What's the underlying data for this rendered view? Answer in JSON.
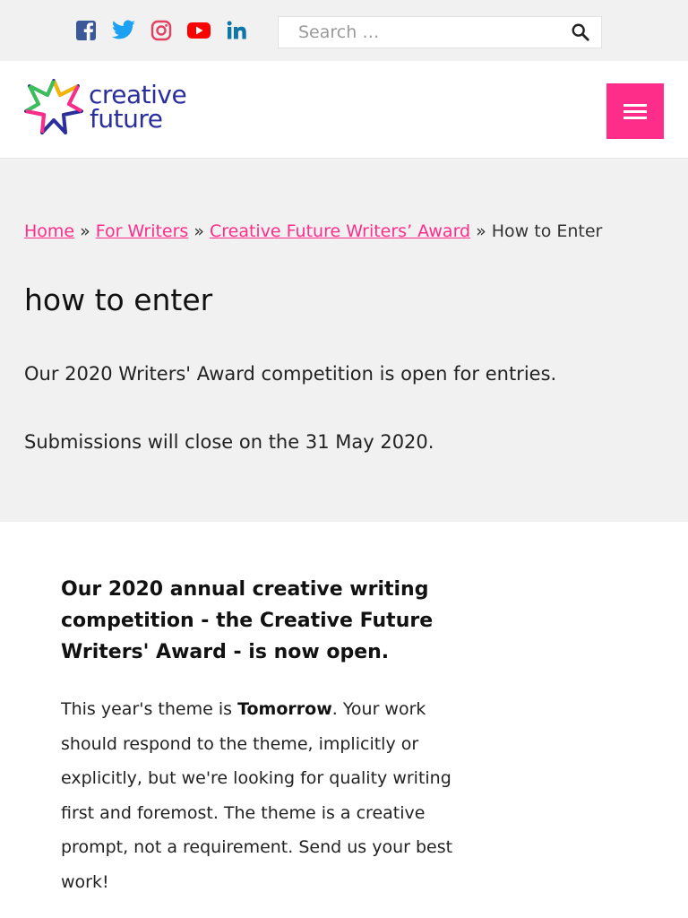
{
  "topbar": {
    "social": [
      {
        "name": "facebook-icon",
        "color": "#3b5998"
      },
      {
        "name": "twitter-icon",
        "color": "#1da1f2"
      },
      {
        "name": "instagram-icon",
        "color": "#e4405f"
      },
      {
        "name": "youtube-icon",
        "color": "#ff0000"
      },
      {
        "name": "linkedin-icon",
        "color": "#0e76a8"
      }
    ],
    "search": {
      "placeholder": "Search …",
      "icon": "search-icon"
    }
  },
  "header": {
    "logo": {
      "line1": "creative",
      "line2": "future",
      "color": "#2a2f9c"
    },
    "menu_icon": "hamburger-menu-icon",
    "menu_color": "#ff2d8a"
  },
  "breadcrumb": {
    "home": "Home",
    "for_writers": "For Writers",
    "award": "Creative Future Writers’ Award",
    "current": "How to Enter",
    "separator": "»"
  },
  "hero": {
    "title": "how to enter",
    "p1": "Our 2020 Writers' Award competition is open for entries.",
    "p2": "Submissions will close on the 31 May 2020."
  },
  "content": {
    "heading": "Our 2020 annual creative writing competition - the Creative Future Writers' Award - is now open.",
    "body_pre": "This year's theme is ",
    "body_bold": "Tomorrow",
    "body_post": ". Your work should respond to the theme, implicitly or explicitly, but we're looking for quality writing first and foremost. The theme is a creative prompt, not a requirement. Send us your best work!"
  },
  "colors": {
    "accent": "#ff2d8a",
    "bg_grey": "#f1f1f1",
    "brand_blue": "#2a2f9c"
  }
}
